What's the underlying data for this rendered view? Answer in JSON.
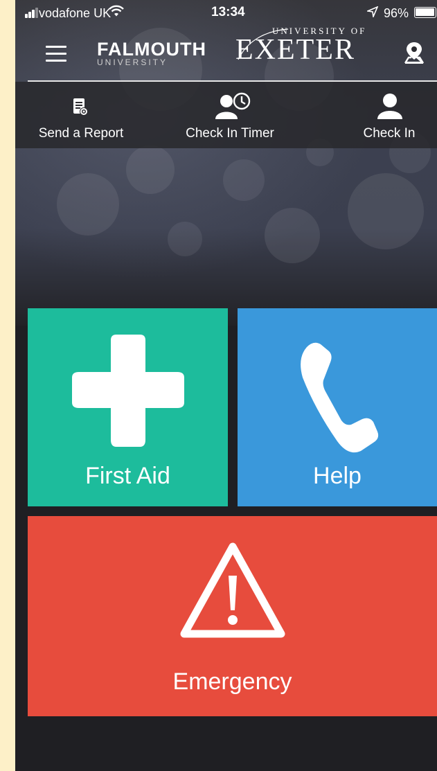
{
  "status_bar": {
    "carrier": "vodafone UK",
    "time": "13:34",
    "battery_percent": "96%",
    "battery_level": 0.96
  },
  "header": {
    "logo_left_main": "FALMOUTH",
    "logo_left_sub": "UNIVERSITY",
    "logo_right_top": "UNIVERSITY OF",
    "logo_right_main": "EXETER",
    "menu_icon": "hamburger-menu-icon",
    "map_icon": "map-pin-icon"
  },
  "quick_actions": [
    {
      "label": "Send a Report",
      "icon": "report-icon"
    },
    {
      "label": "Check In Timer",
      "icon": "person-clock-icon"
    },
    {
      "label": "Check In",
      "icon": "person-icon"
    }
  ],
  "tiles": {
    "first_aid": {
      "label": "First Aid",
      "icon": "medical-cross-icon",
      "color": "#1dbc9c"
    },
    "help": {
      "label": "Help",
      "icon": "phone-icon",
      "color": "#3a98db"
    },
    "emergency": {
      "label": "Emergency",
      "icon": "warning-triangle-icon",
      "color": "#e74c3d"
    }
  }
}
